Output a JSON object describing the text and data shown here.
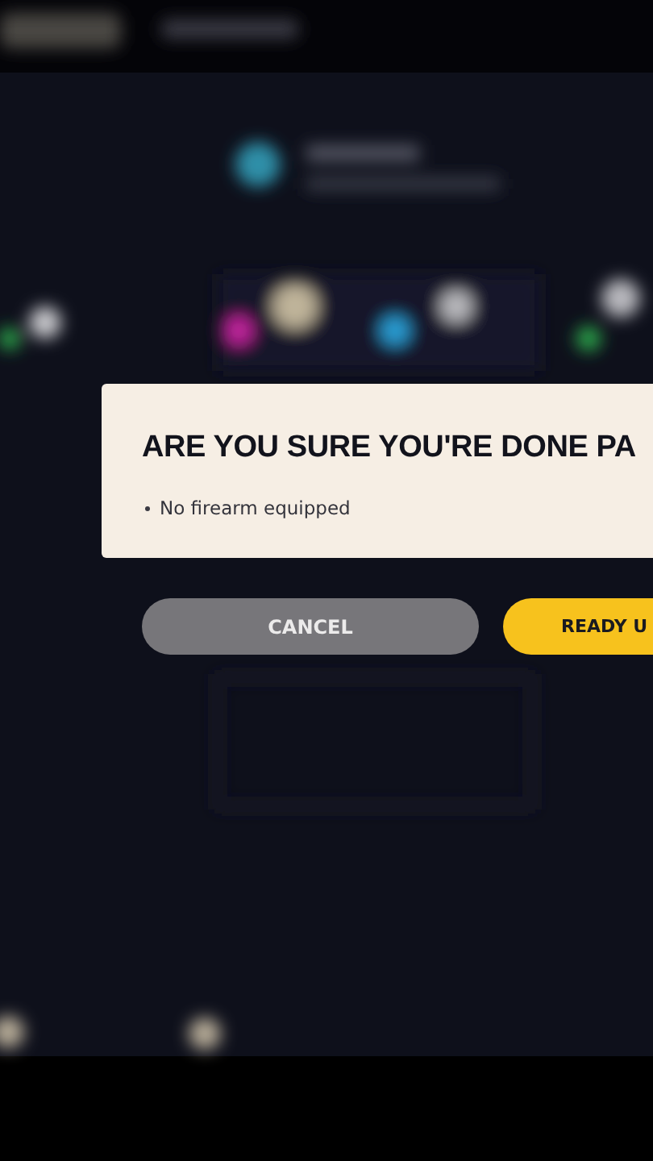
{
  "dialog": {
    "title": "ARE YOU SURE YOU'RE DONE PA",
    "items": [
      "No firearm equipped"
    ]
  },
  "buttons": [
    {
      "kind": "secondary",
      "label": "CANCEL"
    },
    {
      "kind": "primary",
      "label": "READY U"
    }
  ]
}
